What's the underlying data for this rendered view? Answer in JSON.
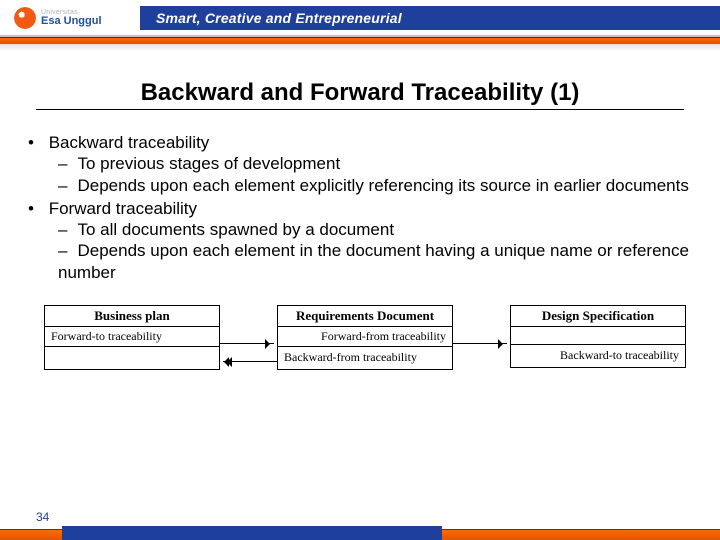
{
  "brand": {
    "uni_small": "Universitas",
    "uni_name": "Esa Unggul",
    "tagline": "Smart, Creative and Entrepreneurial"
  },
  "title": "Backward and Forward Traceability (1)",
  "bullets": {
    "b1": "Backward traceability",
    "b1a": "To previous stages of development",
    "b1b": "Depends upon each element explicitly referencing its source in earlier documents",
    "b2": "Forward traceability",
    "b2a": "To all documents spawned by a document",
    "b2b": "Depends upon each element in the document having a unique name or reference number"
  },
  "diagram": {
    "box1": {
      "title": "Business plan",
      "r1": "Forward-to traceability",
      "r2": ""
    },
    "box2": {
      "title": "Requirements Document",
      "r1": "Forward-from traceability",
      "r2": "Backward-from traceability"
    },
    "box3": {
      "title": "Design Specification",
      "r1": "",
      "r2": "Backward-to traceability"
    }
  },
  "page_number": "34"
}
